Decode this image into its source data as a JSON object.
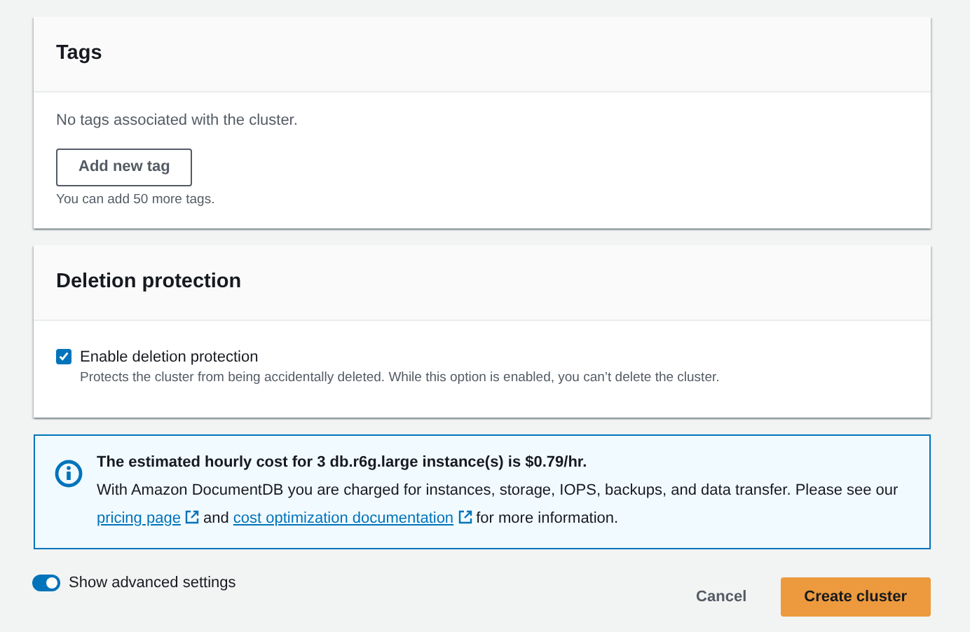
{
  "tags": {
    "title": "Tags",
    "empty_text": "No tags associated with the cluster.",
    "button": "Add new tag",
    "hint": "You can add 50 more tags."
  },
  "deletion_protection": {
    "title": "Deletion protection",
    "checkbox": {
      "label": "Enable deletion protection",
      "description": "Protects the cluster from being accidentally deleted. While this option is enabled, you can’t delete the cluster.",
      "checked": true
    }
  },
  "info_alert": {
    "title": "The estimated hourly cost for 3 db.r6g.large instance(s) is $0.79/hr.",
    "text_before": "With Amazon DocumentDB you are charged for instances, storage, IOPS, backups, and data transfer. Please see our ",
    "link_1": "pricing page",
    "text_middle": " and ",
    "link_2": "cost optimization documentation",
    "text_after": " for more information."
  },
  "advanced_toggle": {
    "label": "Show advanced settings",
    "on": true
  },
  "buttons": [
    {
      "label": "Cancel",
      "kind": "link"
    },
    {
      "label": "Create cluster",
      "kind": "primary"
    }
  ]
}
